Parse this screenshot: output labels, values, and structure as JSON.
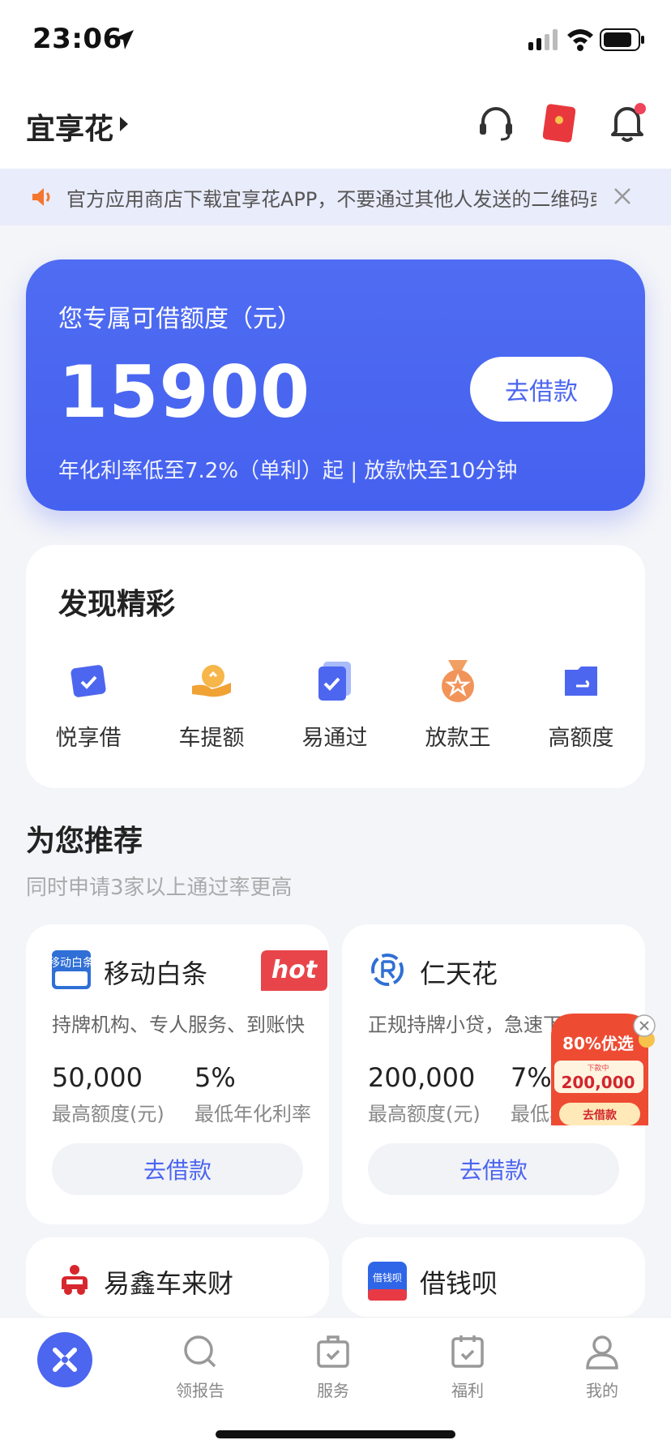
{
  "status_bar": {
    "time": "23:06"
  },
  "header": {
    "title": "宜享花"
  },
  "notice": {
    "text": "官方应用商店下载宜享花APP，不要通过其他人发送的二维码或链接下载"
  },
  "credit": {
    "label": "您专属可借额度（元）",
    "amount": "15900",
    "button": "去借款",
    "subtitle": "年化利率低至7.2%（单利）起 | 放款快至10分钟"
  },
  "discover": {
    "title": "发现精彩",
    "items": [
      {
        "label": "悦享借",
        "icon": "card-check-icon"
      },
      {
        "label": "车提额",
        "icon": "hand-coin-icon"
      },
      {
        "label": "易通过",
        "icon": "document-check-icon"
      },
      {
        "label": "放款王",
        "icon": "medal-icon"
      },
      {
        "label": "高额度",
        "icon": "wallet-icon"
      }
    ]
  },
  "recommend": {
    "title": "为您推荐",
    "subtitle": "同时申请3家以上通过率更高",
    "products": [
      {
        "name": "移动白条",
        "logo_text": "移动白条",
        "badge": "hot",
        "desc": "持牌机构、专人服务、到账快",
        "amount": "50,000",
        "amount_label": "最高额度(元)",
        "rate": "5%",
        "rate_label": "最低年化利率",
        "button": "去借款"
      },
      {
        "name": "仁天花",
        "desc": "正规持牌小贷，急速下款",
        "amount": "200,000",
        "amount_label": "最高额度(元)",
        "rate": "7%",
        "rate_label": "最低年化利率",
        "button": "去借款"
      },
      {
        "name": "易鑫车来财"
      },
      {
        "name": "借钱呗",
        "logo_text": "借钱呗"
      }
    ]
  },
  "float_ad": {
    "headline": "80%优选",
    "small": "下款中",
    "amount": "200,000",
    "button": "去借款"
  },
  "tabbar": {
    "tabs": [
      {
        "label": "",
        "icon": "home-logo-icon"
      },
      {
        "label": "领报告",
        "icon": "search-report-icon"
      },
      {
        "label": "服务",
        "icon": "briefcase-icon"
      },
      {
        "label": "福利",
        "icon": "calendar-gift-icon"
      },
      {
        "label": "我的",
        "icon": "user-icon"
      }
    ]
  },
  "colors": {
    "brand": "#4c66f0",
    "hot": "#e8454a",
    "notice_bg": "#e9ecfb"
  }
}
